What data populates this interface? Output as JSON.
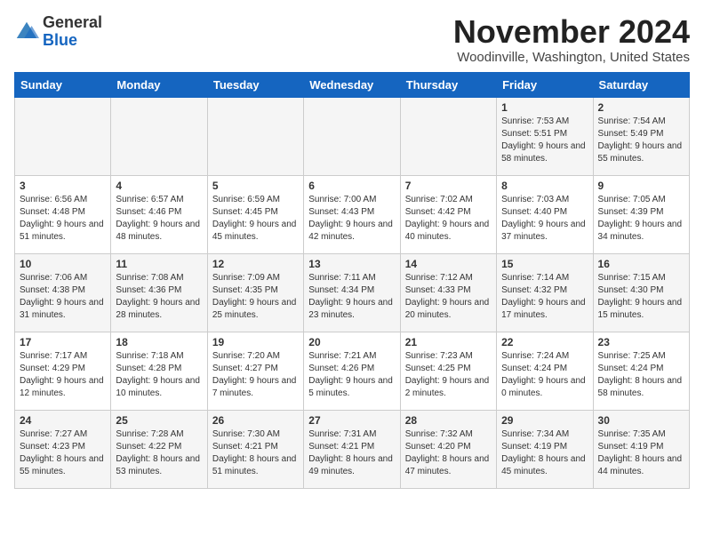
{
  "header": {
    "logo": {
      "line1": "General",
      "line2": "Blue"
    },
    "month_title": "November 2024",
    "location": "Woodinville, Washington, United States"
  },
  "weekdays": [
    "Sunday",
    "Monday",
    "Tuesday",
    "Wednesday",
    "Thursday",
    "Friday",
    "Saturday"
  ],
  "weeks": [
    [
      {
        "day": "",
        "info": ""
      },
      {
        "day": "",
        "info": ""
      },
      {
        "day": "",
        "info": ""
      },
      {
        "day": "",
        "info": ""
      },
      {
        "day": "",
        "info": ""
      },
      {
        "day": "1",
        "info": "Sunrise: 7:53 AM\nSunset: 5:51 PM\nDaylight: 9 hours and 58 minutes."
      },
      {
        "day": "2",
        "info": "Sunrise: 7:54 AM\nSunset: 5:49 PM\nDaylight: 9 hours and 55 minutes."
      }
    ],
    [
      {
        "day": "3",
        "info": "Sunrise: 6:56 AM\nSunset: 4:48 PM\nDaylight: 9 hours and 51 minutes."
      },
      {
        "day": "4",
        "info": "Sunrise: 6:57 AM\nSunset: 4:46 PM\nDaylight: 9 hours and 48 minutes."
      },
      {
        "day": "5",
        "info": "Sunrise: 6:59 AM\nSunset: 4:45 PM\nDaylight: 9 hours and 45 minutes."
      },
      {
        "day": "6",
        "info": "Sunrise: 7:00 AM\nSunset: 4:43 PM\nDaylight: 9 hours and 42 minutes."
      },
      {
        "day": "7",
        "info": "Sunrise: 7:02 AM\nSunset: 4:42 PM\nDaylight: 9 hours and 40 minutes."
      },
      {
        "day": "8",
        "info": "Sunrise: 7:03 AM\nSunset: 4:40 PM\nDaylight: 9 hours and 37 minutes."
      },
      {
        "day": "9",
        "info": "Sunrise: 7:05 AM\nSunset: 4:39 PM\nDaylight: 9 hours and 34 minutes."
      }
    ],
    [
      {
        "day": "10",
        "info": "Sunrise: 7:06 AM\nSunset: 4:38 PM\nDaylight: 9 hours and 31 minutes."
      },
      {
        "day": "11",
        "info": "Sunrise: 7:08 AM\nSunset: 4:36 PM\nDaylight: 9 hours and 28 minutes."
      },
      {
        "day": "12",
        "info": "Sunrise: 7:09 AM\nSunset: 4:35 PM\nDaylight: 9 hours and 25 minutes."
      },
      {
        "day": "13",
        "info": "Sunrise: 7:11 AM\nSunset: 4:34 PM\nDaylight: 9 hours and 23 minutes."
      },
      {
        "day": "14",
        "info": "Sunrise: 7:12 AM\nSunset: 4:33 PM\nDaylight: 9 hours and 20 minutes."
      },
      {
        "day": "15",
        "info": "Sunrise: 7:14 AM\nSunset: 4:32 PM\nDaylight: 9 hours and 17 minutes."
      },
      {
        "day": "16",
        "info": "Sunrise: 7:15 AM\nSunset: 4:30 PM\nDaylight: 9 hours and 15 minutes."
      }
    ],
    [
      {
        "day": "17",
        "info": "Sunrise: 7:17 AM\nSunset: 4:29 PM\nDaylight: 9 hours and 12 minutes."
      },
      {
        "day": "18",
        "info": "Sunrise: 7:18 AM\nSunset: 4:28 PM\nDaylight: 9 hours and 10 minutes."
      },
      {
        "day": "19",
        "info": "Sunrise: 7:20 AM\nSunset: 4:27 PM\nDaylight: 9 hours and 7 minutes."
      },
      {
        "day": "20",
        "info": "Sunrise: 7:21 AM\nSunset: 4:26 PM\nDaylight: 9 hours and 5 minutes."
      },
      {
        "day": "21",
        "info": "Sunrise: 7:23 AM\nSunset: 4:25 PM\nDaylight: 9 hours and 2 minutes."
      },
      {
        "day": "22",
        "info": "Sunrise: 7:24 AM\nSunset: 4:24 PM\nDaylight: 9 hours and 0 minutes."
      },
      {
        "day": "23",
        "info": "Sunrise: 7:25 AM\nSunset: 4:24 PM\nDaylight: 8 hours and 58 minutes."
      }
    ],
    [
      {
        "day": "24",
        "info": "Sunrise: 7:27 AM\nSunset: 4:23 PM\nDaylight: 8 hours and 55 minutes."
      },
      {
        "day": "25",
        "info": "Sunrise: 7:28 AM\nSunset: 4:22 PM\nDaylight: 8 hours and 53 minutes."
      },
      {
        "day": "26",
        "info": "Sunrise: 7:30 AM\nSunset: 4:21 PM\nDaylight: 8 hours and 51 minutes."
      },
      {
        "day": "27",
        "info": "Sunrise: 7:31 AM\nSunset: 4:21 PM\nDaylight: 8 hours and 49 minutes."
      },
      {
        "day": "28",
        "info": "Sunrise: 7:32 AM\nSunset: 4:20 PM\nDaylight: 8 hours and 47 minutes."
      },
      {
        "day": "29",
        "info": "Sunrise: 7:34 AM\nSunset: 4:19 PM\nDaylight: 8 hours and 45 minutes."
      },
      {
        "day": "30",
        "info": "Sunrise: 7:35 AM\nSunset: 4:19 PM\nDaylight: 8 hours and 44 minutes."
      }
    ]
  ]
}
